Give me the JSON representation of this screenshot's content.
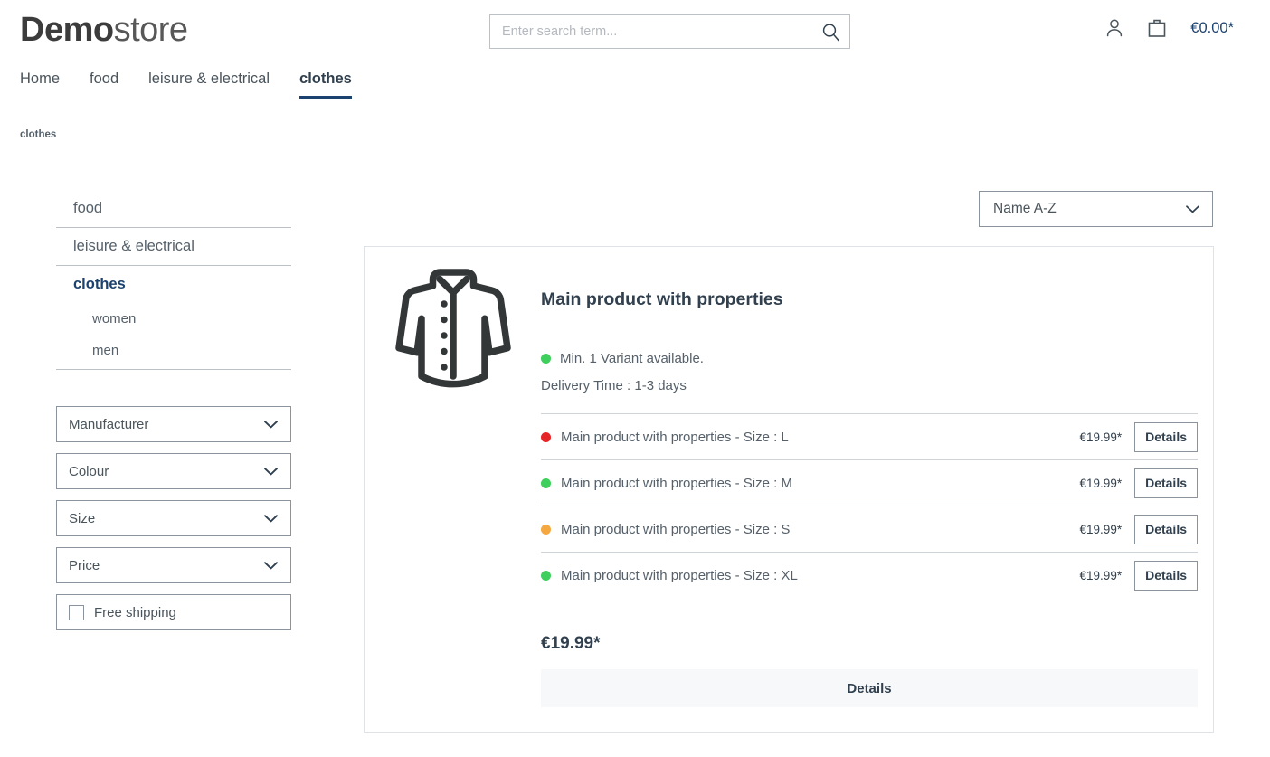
{
  "header": {
    "logo_bold": "Demo",
    "logo_light": "store",
    "search": {
      "placeholder": "Enter search term...",
      "value": "",
      "icon": "search-icon"
    },
    "account_icon": "user-icon",
    "cart_icon": "shopping-bag-icon",
    "cart_total": "€0.00*",
    "accent_color": "#1c4370"
  },
  "mainnav": {
    "items": [
      {
        "label": "Home",
        "active": false
      },
      {
        "label": "food",
        "active": false
      },
      {
        "label": "leisure & electrical",
        "active": false
      },
      {
        "label": "clothes",
        "active": true
      }
    ]
  },
  "breadcrumb": {
    "text": "clothes"
  },
  "sidebar": {
    "categories": [
      {
        "label": "food",
        "level": 1,
        "active": false
      },
      {
        "label": "leisure & electrical",
        "level": 1,
        "active": false
      },
      {
        "label": "clothes",
        "level": 1,
        "active": true
      },
      {
        "label": "women",
        "level": 2,
        "active": false
      },
      {
        "label": "men",
        "level": 2,
        "active": false
      }
    ],
    "filters": [
      {
        "label": "Manufacturer",
        "icon": "chevron-down-icon"
      },
      {
        "label": "Colour",
        "icon": "chevron-down-icon"
      },
      {
        "label": "Size",
        "icon": "chevron-down-icon"
      },
      {
        "label": "Price",
        "icon": "chevron-down-icon"
      }
    ],
    "free_shipping": {
      "label": "Free shipping",
      "checked": false
    }
  },
  "sort": {
    "selected": "Name A-Z",
    "icon": "chevron-down-icon"
  },
  "product": {
    "image_icon": "jacket-icon",
    "title": "Main product with properties",
    "availability": {
      "text": "Min. 1 Variant available.",
      "dot_color": "#3ecf5c"
    },
    "delivery": "Delivery Time : 1-3 days",
    "variants": [
      {
        "name": "Main product with properties - Size : L",
        "price": "€19.99*",
        "dot_color": "#e52427",
        "button": "Details"
      },
      {
        "name": "Main product with properties - Size : M",
        "price": "€19.99*",
        "dot_color": "#3ecf5c",
        "button": "Details"
      },
      {
        "name": "Main product with properties - Size : S",
        "price": "€19.99*",
        "dot_color": "#f5a840",
        "button": "Details"
      },
      {
        "name": "Main product with properties - Size : XL",
        "price": "€19.99*",
        "dot_color": "#3ecf5c",
        "button": "Details"
      }
    ],
    "price": "€19.99*",
    "details_button": "Details"
  }
}
